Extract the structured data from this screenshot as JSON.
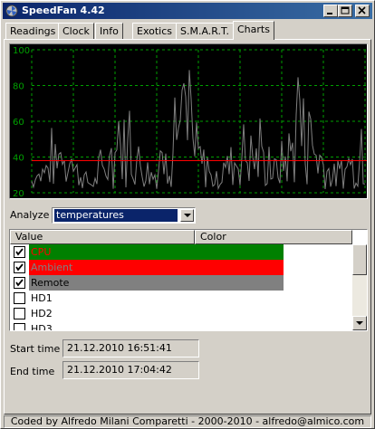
{
  "window": {
    "title": "SpeedFan 4.42"
  },
  "title_buttons": {
    "minimize": "_",
    "maximize": "□",
    "close": "×"
  },
  "tabs": [
    {
      "label": "Readings"
    },
    {
      "label": "Clock"
    },
    {
      "label": "Info"
    },
    {
      "label": "Exotics"
    },
    {
      "label": "S.M.A.R.T."
    },
    {
      "label": "Charts"
    }
  ],
  "active_tab": "Charts",
  "chart": {
    "y_ticks": [
      "100",
      "80",
      "60",
      "40",
      "20"
    ],
    "background": "#000000",
    "grid_color": "#00a000",
    "series_colors": {
      "cpu": "#008000",
      "ambient": "#ff0000",
      "remote": "#808080"
    }
  },
  "chart_data": {
    "type": "line",
    "ylim": [
      20,
      100
    ],
    "yticks": [
      100,
      80,
      60,
      40,
      20
    ],
    "grid": true,
    "series": [
      {
        "name": "Ambient",
        "color": "#ff0000",
        "values": [
          38,
          38,
          38,
          38,
          38,
          38,
          38,
          38,
          38,
          38,
          38,
          38
        ]
      },
      {
        "name": "Remote",
        "color": "#808080",
        "values_note_shape": "noisy",
        "values": [
          30,
          55,
          25,
          70,
          35,
          90,
          28,
          65,
          40,
          85,
          30,
          60
        ]
      }
    ]
  },
  "analyze": {
    "label": "Analyze",
    "selected": "temperatures"
  },
  "list": {
    "headers": {
      "value": "Value",
      "color": "Color"
    },
    "items": [
      {
        "label": "CPU",
        "checked": true,
        "color": "#008000",
        "text_color": "#ff0000"
      },
      {
        "label": "Ambient",
        "checked": true,
        "color": "#ff0000",
        "text_color": "#808080"
      },
      {
        "label": "Remote",
        "checked": true,
        "color": "#808080",
        "text_color": "#000000"
      },
      {
        "label": "HD1",
        "checked": false,
        "color": "",
        "text_color": "#000000"
      },
      {
        "label": "HD2",
        "checked": false,
        "color": "",
        "text_color": "#000000"
      },
      {
        "label": "HD3",
        "checked": false,
        "color": "",
        "text_color": "#000000"
      }
    ]
  },
  "times": {
    "start_label": "Start time",
    "start_value": "21.12.2010 16:51:41",
    "end_label": "End time",
    "end_value": "21.12.2010 17:04:42"
  },
  "status": "Coded by Alfredo Milani Comparetti - 2000-2010 - alfredo@almico.com"
}
